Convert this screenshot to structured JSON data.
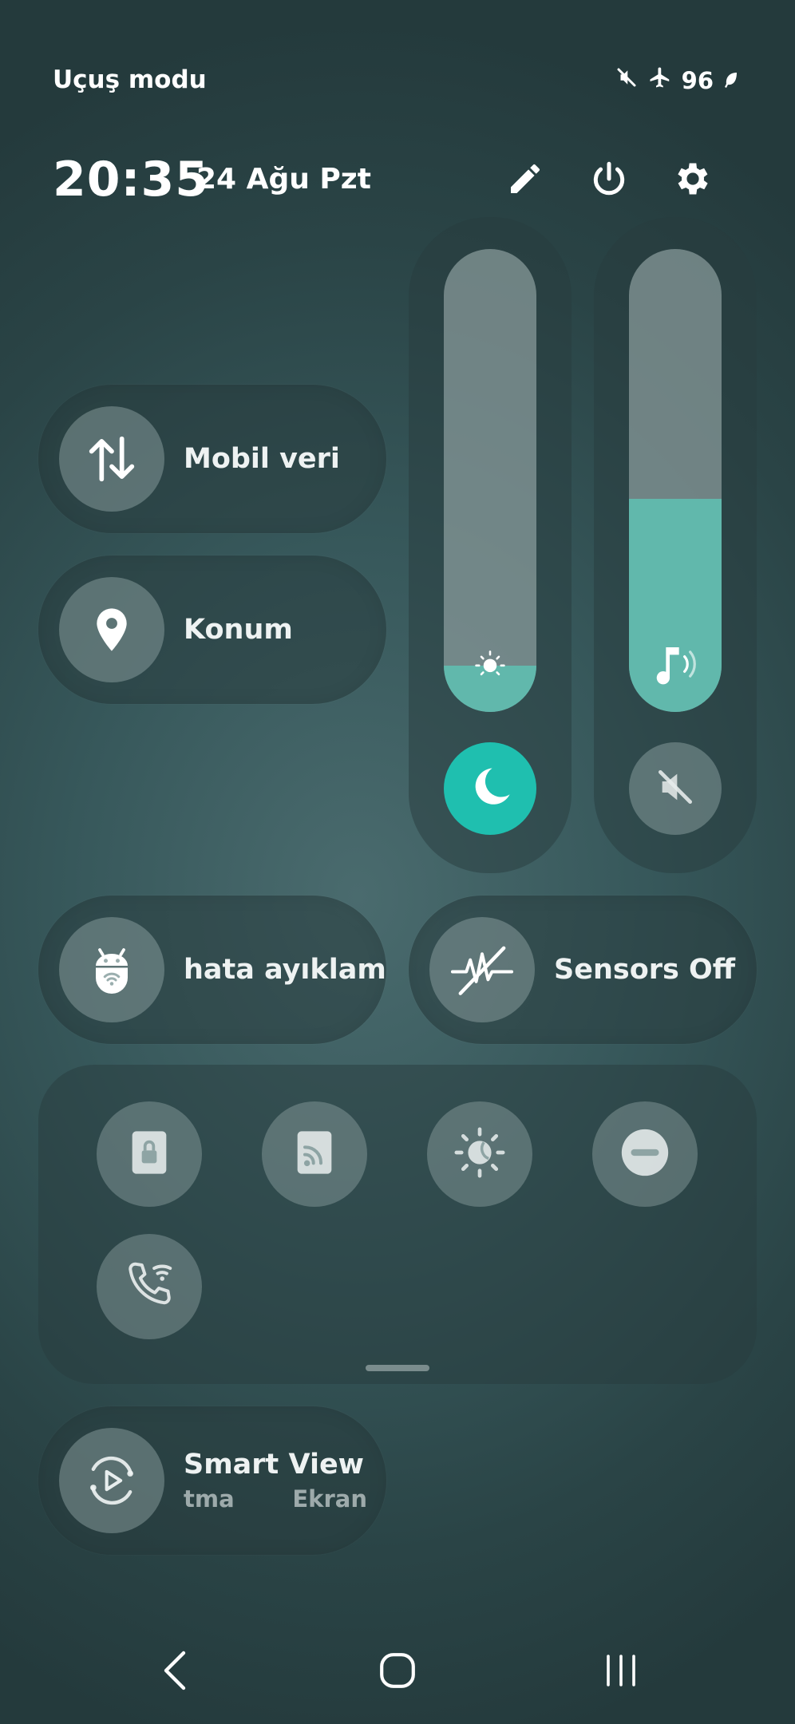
{
  "status_bar": {
    "mode_label": "Uçuş modu",
    "battery": "96",
    "icons": [
      "mute-icon",
      "airplane-icon",
      "battery-saver-icon"
    ]
  },
  "header": {
    "time": "20:35",
    "date": "24 Ağu Pzt",
    "icons": [
      "edit-icon",
      "power-icon",
      "settings-icon"
    ]
  },
  "tiles": {
    "mobile_data": {
      "label": "Mobil veri",
      "icon": "data-arrows-icon"
    },
    "location": {
      "label": "Konum",
      "icon": "location-pin-icon"
    },
    "debugging": {
      "label": "hata ayıklam",
      "icon": "android-bug-icon"
    },
    "sensors": {
      "label": "Sensors Off",
      "icon": "sensors-off-icon"
    },
    "smart_view": {
      "label": "Smart View",
      "sublabel_left": "tma",
      "sublabel_right": "Ekran",
      "icon": "smart-view-icon"
    }
  },
  "sliders": {
    "brightness": {
      "level": 0.1,
      "icon": "sun-icon",
      "button_icon": "moon-icon",
      "button_active": true
    },
    "volume": {
      "level": 0.46,
      "icon": "music-note-icon",
      "button_icon": "mute-icon",
      "button_active": false
    }
  },
  "quick_grid": {
    "buttons": [
      "secure-folder-icon",
      "cast-icon",
      "eye-comfort-icon",
      "do-not-disturb-icon",
      "wifi-calling-icon"
    ]
  },
  "navigation": [
    "back-icon",
    "home-icon",
    "recents-icon"
  ],
  "colors": {
    "accent": "#1fbfaf",
    "slider_fill": "#61b8ac"
  }
}
